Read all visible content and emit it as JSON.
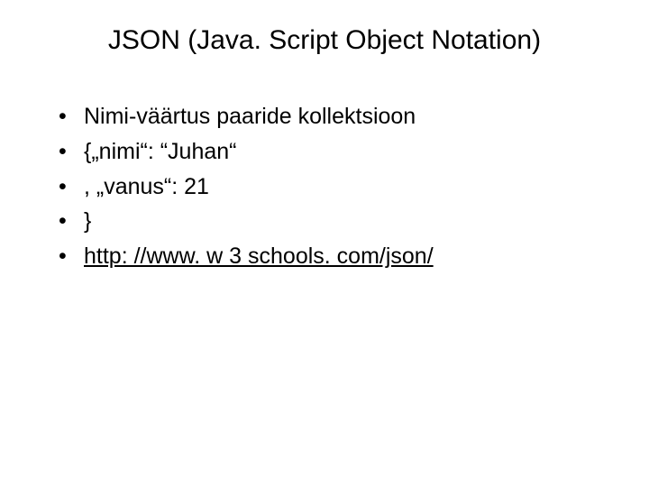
{
  "title": "JSON (Java. Script Object Notation)",
  "bullets": [
    {
      "text": "Nimi-väärtus paaride kollektsioon",
      "link": false
    },
    {
      "text": "{„nimi“: “Juhan“",
      "link": false
    },
    {
      "text": ", „vanus“: 21",
      "link": false
    },
    {
      "text": "}",
      "link": false
    },
    {
      "text": "http: //www. w 3 schools. com/json/",
      "link": true
    }
  ]
}
